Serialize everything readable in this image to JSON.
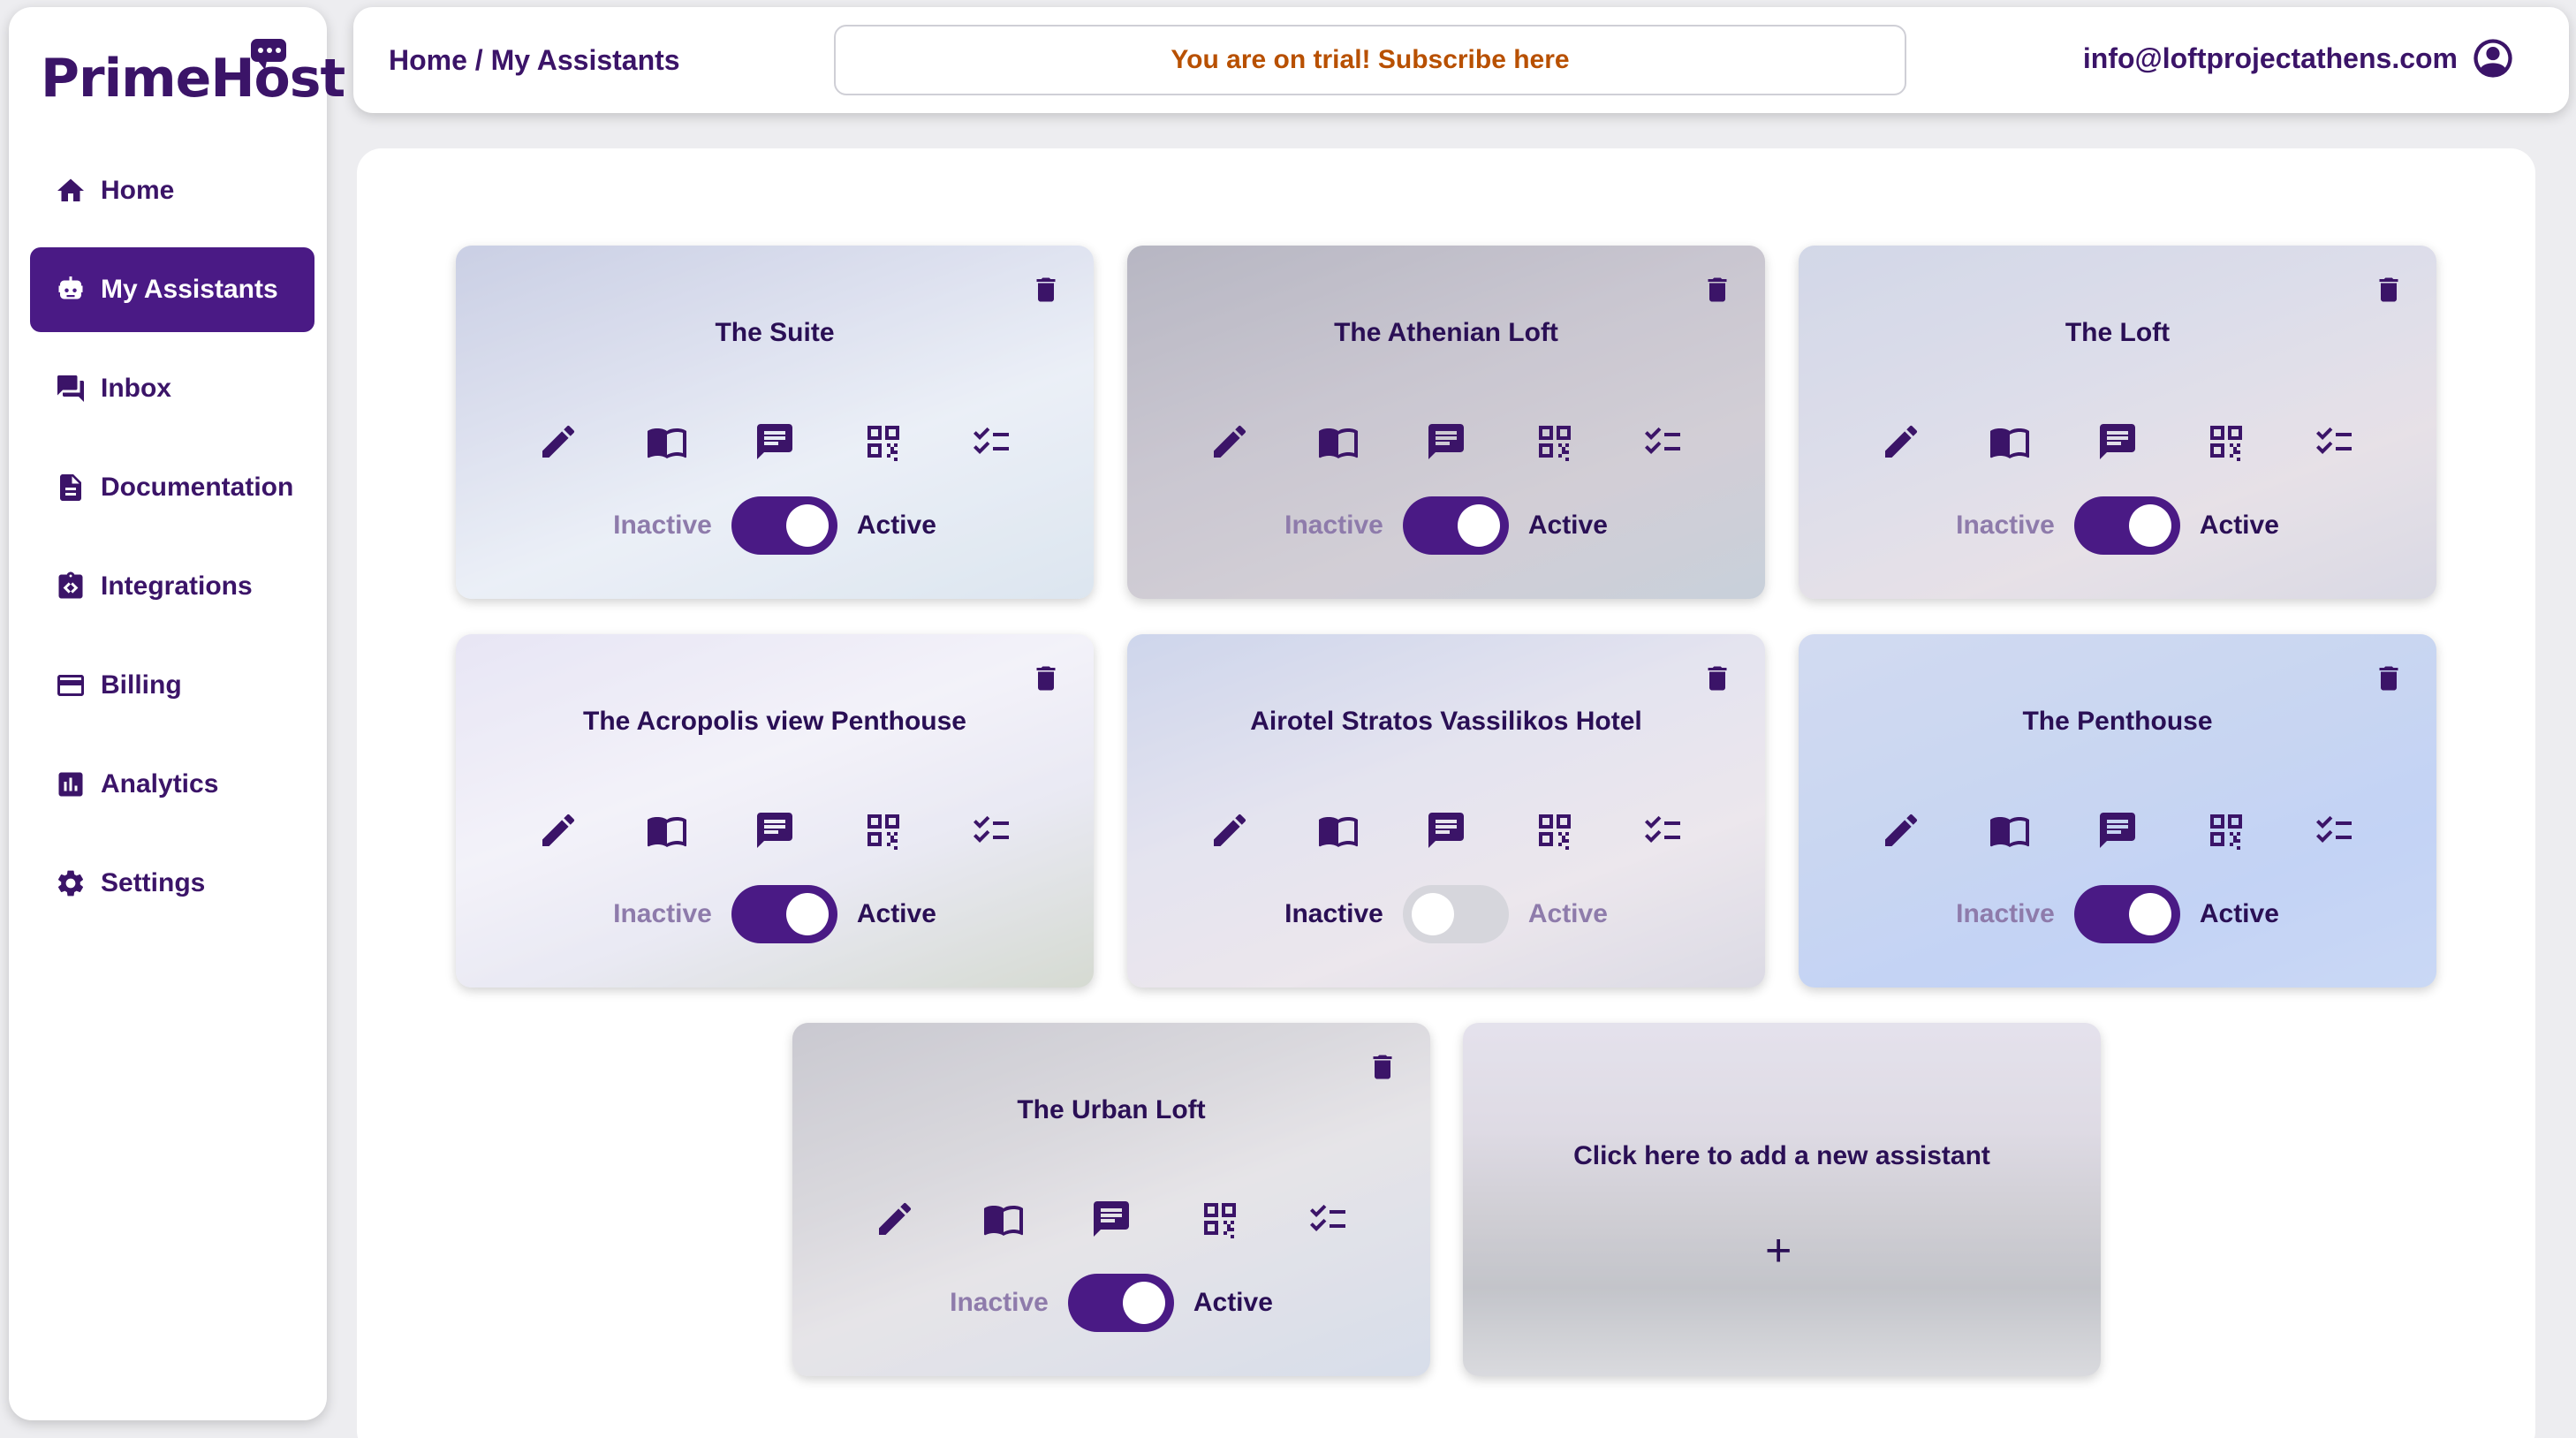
{
  "brand": {
    "name": "PrimeHost"
  },
  "sidebar": {
    "items": [
      {
        "label": "Home",
        "icon": "home-icon",
        "active": false
      },
      {
        "label": "My Assistants",
        "icon": "robot-icon",
        "active": true
      },
      {
        "label": "Inbox",
        "icon": "chat-icon",
        "active": false
      },
      {
        "label": "Documentation",
        "icon": "document-icon",
        "active": false
      },
      {
        "label": "Integrations",
        "icon": "code-icon",
        "active": false
      },
      {
        "label": "Billing",
        "icon": "credit-card-icon",
        "active": false
      },
      {
        "label": "Analytics",
        "icon": "bar-chart-icon",
        "active": false
      },
      {
        "label": "Settings",
        "icon": "gear-icon",
        "active": false
      }
    ]
  },
  "header": {
    "breadcrumb": "Home / My Assistants",
    "trial_text": "You are on trial! Subscribe here",
    "account_email": "info@loftprojectathens.com"
  },
  "colors": {
    "accent": "#4a1a85",
    "text": "#3b1468",
    "trial": "#b85000"
  },
  "toggle_labels": {
    "inactive": "Inactive",
    "active": "Active"
  },
  "assistants": [
    {
      "name": "The Suite",
      "active": true
    },
    {
      "name": "The Athenian Loft",
      "active": true
    },
    {
      "name": "The Loft",
      "active": true
    },
    {
      "name": "The Acropolis view Penthouse",
      "active": true
    },
    {
      "name": "Airotel Stratos Vassilikos Hotel",
      "active": false
    },
    {
      "name": "The Penthouse",
      "active": true
    },
    {
      "name": "The Urban Loft",
      "active": true
    }
  ],
  "card_actions": [
    "edit-icon",
    "book-icon",
    "chat-icon",
    "qr-code-icon",
    "checklist-icon"
  ],
  "add_card": {
    "label": "Click here to add a new assistant",
    "plus": "+"
  }
}
